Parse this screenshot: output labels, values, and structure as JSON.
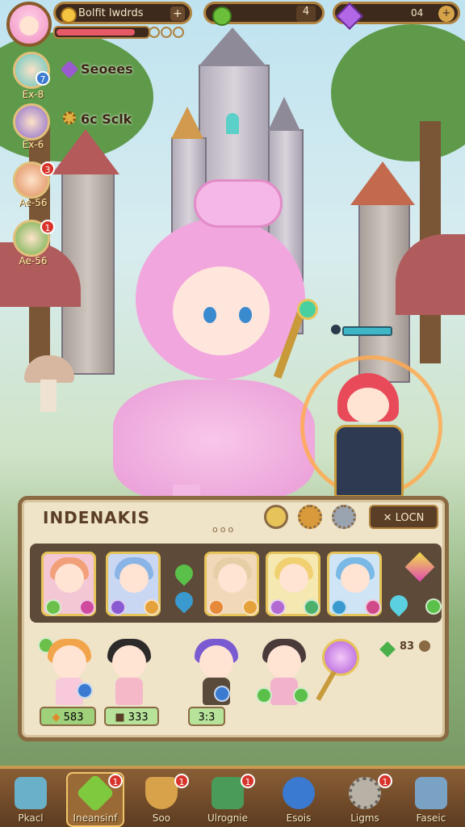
{
  "top_bar": {
    "player_name": "Bolfit lwdrds",
    "xp_progress": 0.87,
    "gem_value": "4",
    "crystal_value": "04"
  },
  "side_menu": [
    {
      "label": "Ex-8",
      "badge": "7",
      "badge_kind": "blue",
      "text": "Seoees"
    },
    {
      "label": "Ex-6",
      "badge": "",
      "badge_kind": "",
      "text": "6c Sclk"
    },
    {
      "label": "Ae-56",
      "badge": "3",
      "badge_kind": "red",
      "text": ""
    },
    {
      "label": "Ae-56",
      "badge": "1",
      "badge_kind": "red",
      "text": ""
    }
  ],
  "enemy_tag": "",
  "panel": {
    "title": "INDENAKIS",
    "lock_label": "LOCN",
    "dots": "ooo",
    "row2_count": "83",
    "stats": [
      {
        "value": "583"
      },
      {
        "value": "333"
      },
      {
        "value": "3:3"
      }
    ]
  },
  "bottom_nav": [
    {
      "label": "Pkacl",
      "badge": "",
      "icon": "cube-icon",
      "color": "#6ab0c8"
    },
    {
      "label": "Ineansinf",
      "badge": "1",
      "icon": "gem-icon",
      "color": "#7ec93e"
    },
    {
      "label": "Soo",
      "badge": "1",
      "icon": "shield-icon",
      "color": "#d7a24a"
    },
    {
      "label": "Ulrognie",
      "badge": "1",
      "icon": "chest-icon",
      "color": "#4a9a5a"
    },
    {
      "label": "Esois",
      "badge": "",
      "icon": "crest-icon",
      "color": "#3a7ad0"
    },
    {
      "label": "Ligms",
      "badge": "1",
      "icon": "gear-icon",
      "color": "#b8b2a6"
    },
    {
      "label": "Faseic",
      "badge": "",
      "icon": "tools-icon",
      "color": "#7aa2c4"
    }
  ],
  "colors": {
    "frame": "#8a6a43",
    "accent_gold": "#e6c45a",
    "badge_red": "#d9342b"
  }
}
